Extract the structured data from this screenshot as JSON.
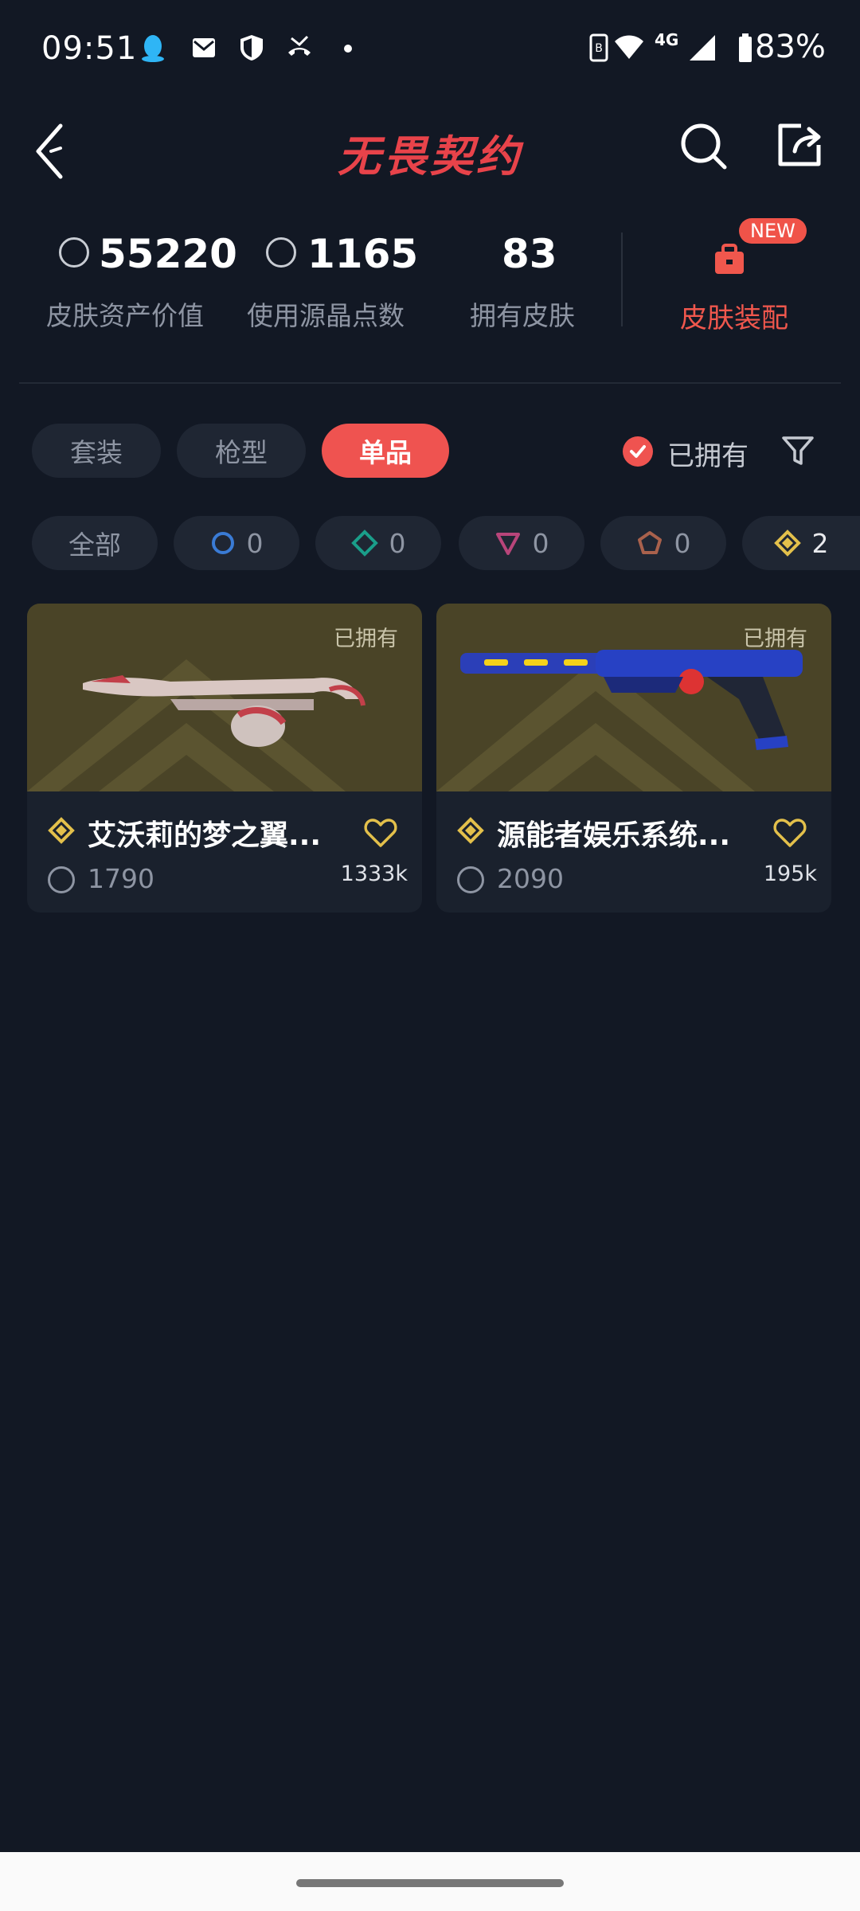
{
  "status_bar": {
    "time": "09:51",
    "network": "4G",
    "battery": "83%"
  },
  "header": {
    "title": "无畏契约"
  },
  "stats": [
    {
      "value": "55220",
      "label": "皮肤资产价值"
    },
    {
      "value": "1165",
      "label": "使用源晶点数"
    },
    {
      "value": "83",
      "label": "拥有皮肤"
    }
  ],
  "equip": {
    "badge": "NEW",
    "label": "皮肤装配"
  },
  "tabs": [
    "套装",
    "枪型",
    "单品"
  ],
  "owned_filter": {
    "label": "已拥有"
  },
  "rarity_chips": [
    {
      "label": "全部"
    },
    {
      "count": "0"
    },
    {
      "count": "0"
    },
    {
      "count": "0"
    },
    {
      "count": "0"
    },
    {
      "count": "2"
    }
  ],
  "cards": [
    {
      "owned": "已拥有",
      "name": "艾沃莉的梦之翼...",
      "price": "1790",
      "likes": "1333k"
    },
    {
      "owned": "已拥有",
      "name": "源能者娱乐系统...",
      "price": "2090",
      "likes": "195k"
    }
  ],
  "colors": {
    "accent": "#ef5350",
    "background": "#121824",
    "gold": "#e3c04b"
  }
}
